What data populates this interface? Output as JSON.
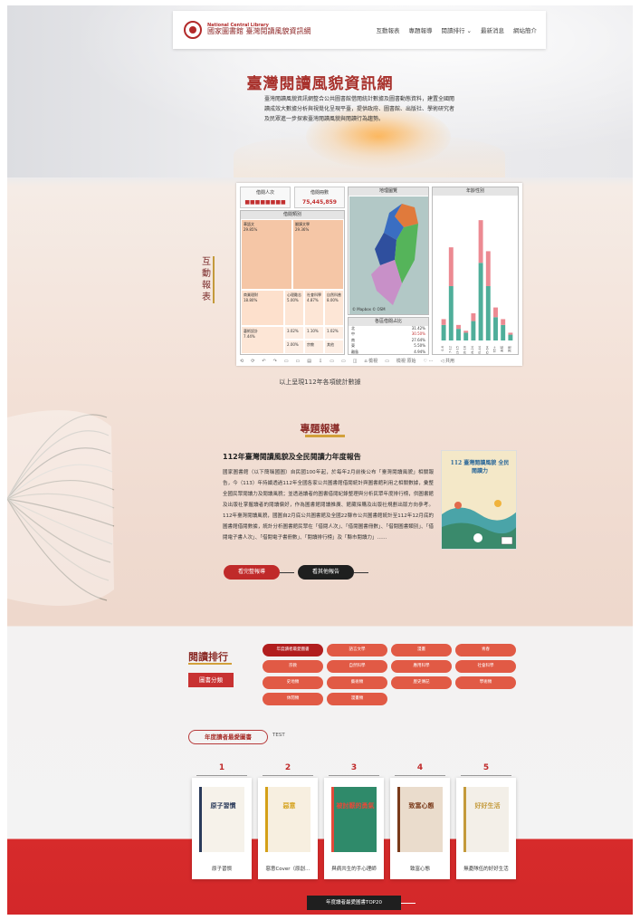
{
  "nav": {
    "logo_en": "National Central Library",
    "logo_zh": "國家圖書館 臺灣閱讀風貌資訊網",
    "links": [
      "互動報表",
      "專題報導",
      "閱讀排行 ⌄",
      "最新消息",
      "網站簡介"
    ]
  },
  "hero": {
    "title": "臺灣閱讀風貌資訊網",
    "description": "臺灣閱讀風貌資訊網整合公共圖書館借閱統計數據及圖書動態資料，建置全國閱讀成效大數據分析與視覺化呈現平臺，提供政府、圖書館、出版社、學術研究者及民眾進一步探索臺灣閱讀風貌與閱讀行為趨勢。"
  },
  "interactive": {
    "side_title": "互動報表",
    "kpi_people_label": "借閱人次",
    "kpi_people_value": "■■■■■■■■",
    "kpi_books_label": "借閱冊數",
    "kpi_books_value": "75,445,859",
    "treemap_head": "借閱類別",
    "map_head": "地理圖覽",
    "map_note": "© Mapbox © OSM",
    "bar_head": "年齡性別",
    "ratio_head": "各區借閱占比",
    "caption": "以上呈現112年各項統計數據"
  },
  "treemap_cells": [
    {
      "name": "華語文",
      "value": "29.85%"
    },
    {
      "name": "翻譯文學",
      "value": "29.36%"
    },
    {
      "name": "商業理財",
      "value": "18.80%"
    },
    {
      "name": "心理勵志",
      "value": "5.00%"
    },
    {
      "name": "社會科學",
      "value": "4.87%"
    },
    {
      "name": "自然科普",
      "value": "8.00%"
    },
    {
      "name": "藝術設計",
      "value": "7.44%"
    },
    {
      "name": "語言學習",
      "value": "3.02%"
    },
    {
      "name": "醫療保健",
      "value": "1.10%"
    },
    {
      "name": "電腦資訊",
      "value": "1.02%"
    },
    {
      "name": "旅遊",
      "value": "2.00%"
    },
    {
      "name": "宗教",
      "value": ""
    },
    {
      "name": "其他",
      "value": ""
    }
  ],
  "ratio_rows": [
    {
      "label": "北",
      "value": "31.42%"
    },
    {
      "label": "中",
      "value": "30.50%"
    },
    {
      "label": "南",
      "value": "27.64%"
    },
    {
      "label": "東",
      "value": "5.50%"
    },
    {
      "label": "離島",
      "value": "4.94%"
    }
  ],
  "dash_footer": [
    "⟲",
    "⟳",
    "↶",
    "↷",
    "▭",
    "▭",
    "▤",
    "⇩",
    "▭",
    "▭",
    "◫",
    "⌂ 檢視",
    "▭",
    "檢視 原始",
    "♡ ⋯",
    "◁ 共用"
  ],
  "feature": {
    "section_title": "專題報導",
    "report_title": "112年臺灣閱讀風貌及全民閱讀力年度報告",
    "report_body": "國家圖書館（以下簡稱國圖）自民國100年起，於每年2月前後公布「臺灣閱讀風貌」相關報告，今（113）年持續透過112年全國各家公共圖書館借閱統計與圖書館利用之相關數據，彙整全國民眾閱讀力及閱讀風貌；並透過讀者的圖書借閱紀錄整理與分析民眾年度排行榜，供圖書館及出版社掌握讀者的閱讀偏好，作為圖書館閱讀推廣、館藏採購及出版社規劃出版方向參考。112年臺灣閱讀風貌，國圖自2月底公共圖書館及全國22縣市公共圖書館統計至112年12月底的圖書館借閱數據，統計分析圖書館民眾在「借閱人次」、「借閱圖書冊數」、「借閱圖書類別」、「借閱電子書人次」、「借閱電子書冊數」、「閱讀排行榜」及「縣市閱讀力」……",
    "cover_title": "112 臺灣閱讀風貌 全民閱讀力",
    "btn_more": "看完整報導",
    "btn_other": "看其他報告"
  },
  "ranking": {
    "title": "閱讀排行",
    "category_btn": "圖書分類",
    "pills": [
      "年度讀者最愛圖書",
      "語言文學",
      "漫畫",
      "青春",
      "宗教",
      "自然科學",
      "應用科學",
      "社會科學",
      "史地類",
      "藝術類",
      "歷史傳記",
      "學術類",
      "休閒類",
      "漫畫類"
    ],
    "popular_title": "年度讀者最愛圖書",
    "popular_test": "TEST",
    "books": [
      {
        "rank": "1",
        "name": "原子習慣",
        "cover": "原子習慣"
      },
      {
        "rank": "2",
        "name": "惡意Cover（原創…",
        "cover": "惡意"
      },
      {
        "rank": "3",
        "name": "與病共生的手心理師",
        "cover": "被討厭的勇氣"
      },
      {
        "rank": "4",
        "name": "致富心態",
        "cover": "致富心態"
      },
      {
        "rank": "5",
        "name": "無憂隊伍的好好生活",
        "cover": "好好生活"
      }
    ],
    "top_btn": "年度讀者最愛圖書TOP20"
  },
  "colors": {
    "brand_red": "#c83232",
    "pill": "#e15a45",
    "gold": "#d2a03a",
    "teal_bar": "#4fae9a",
    "pink_bar": "#ec8a92"
  },
  "chart_data": {
    "type": "bar",
    "title": "年齡性別",
    "categories": [
      "0-6",
      "7-12",
      "13-15",
      "16-18",
      "19-24",
      "25-44",
      "45-64",
      "65+",
      "未知",
      "其他"
    ],
    "series": [
      {
        "values": [
          8,
          28,
          6,
          4,
          10,
          40,
          28,
          12,
          8,
          3
        ]
      },
      {
        "values": [
          3,
          20,
          2,
          1,
          4,
          22,
          18,
          5,
          3,
          1
        ]
      }
    ],
    "ylim": [
      0,
      70
    ]
  }
}
